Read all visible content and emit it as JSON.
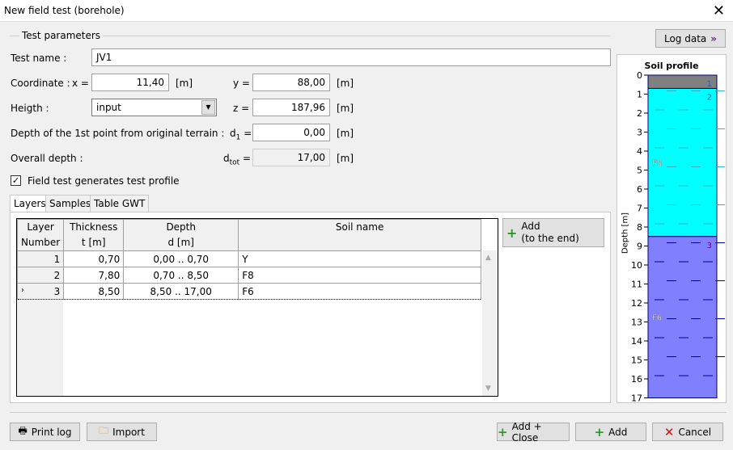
{
  "window": {
    "title": "New field test (borehole)"
  },
  "group_label": "Test parameters",
  "log_data_label": "Log data",
  "fields": {
    "test_name_label": "Test name :",
    "test_name": "JV1",
    "coordinate_label": "Coordinate :",
    "x_label": "x =",
    "x": "11,40",
    "x_unit": "[m]",
    "y_label": "y =",
    "y": "88,00",
    "y_unit": "[m]",
    "height_label": "Heigth :",
    "height_mode": "input",
    "z_label": "z =",
    "z": "187,96",
    "z_unit": "[m]",
    "depth1_label": "Depth of the 1st point from original terrain :",
    "d1_label": "d",
    "d1_sub": "1",
    "d1_eq": " =",
    "d1": "0,00",
    "d1_unit": "[m]",
    "overall_label": "Overall depth :",
    "dtot_label": "d",
    "dtot_sub": "tot",
    "dtot_eq": " =",
    "dtot": "17,00",
    "dtot_unit": "[m]",
    "generates_profile_label": "Field test generates test profile",
    "generates_profile_checked": true
  },
  "tabs": [
    "Layers",
    "Samples",
    "Table GWT"
  ],
  "table": {
    "headers": [
      [
        "Layer",
        "Number"
      ],
      [
        "Thickness",
        "t [m]"
      ],
      [
        "Depth",
        "d [m]"
      ],
      [
        "Soil name",
        ""
      ]
    ],
    "rows": [
      {
        "num": "1",
        "thickness": "0,70",
        "depth": "0,00 .. 0,70",
        "soil": "Y"
      },
      {
        "num": "2",
        "thickness": "7,80",
        "depth": "0,70 .. 8,50",
        "soil": "F8"
      },
      {
        "num": "3",
        "thickness": "8,50",
        "depth": "8,50 .. 17,00",
        "soil": "F6"
      }
    ]
  },
  "add_end": {
    "line1": "Add",
    "line2": "(to the end)"
  },
  "profile": {
    "title": "Soil profile",
    "axis_label": "Depth [m]",
    "ticks": [
      "0",
      "1",
      "2",
      "3",
      "4",
      "5",
      "6",
      "7",
      "8",
      "9",
      "10",
      "11",
      "12",
      "13",
      "14",
      "15",
      "16",
      "17"
    ],
    "layers": [
      {
        "num": "1",
        "name": "",
        "from": 0,
        "to": 0.7,
        "color": "#808080"
      },
      {
        "num": "2",
        "name": "F8",
        "from": 0.7,
        "to": 8.5,
        "color": "#00ffff"
      },
      {
        "num": "3",
        "name": "F6",
        "from": 8.5,
        "to": 17,
        "color": "#8080ff"
      }
    ]
  },
  "buttons": {
    "print_log": "Print log",
    "import": "Import",
    "add_close": "Add + Close",
    "add": "Add",
    "cancel": "Cancel"
  }
}
